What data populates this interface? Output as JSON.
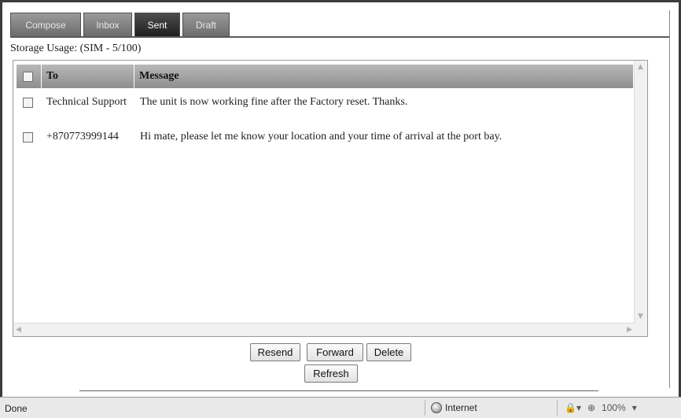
{
  "tabs": [
    {
      "label": "Compose",
      "active": false
    },
    {
      "label": "Inbox",
      "active": false
    },
    {
      "label": "Sent",
      "active": true
    },
    {
      "label": "Draft",
      "active": false
    }
  ],
  "storage_label": "Storage Usage: (SIM - 5/100)",
  "table": {
    "columns": [
      "To",
      "Message"
    ],
    "rows": [
      {
        "to": "Technical Support",
        "message": "The unit is now working fine after the Factory reset. Thanks."
      },
      {
        "to": "+870773999144",
        "message": "Hi mate, please let me know your location and your time of arrival at the port bay."
      }
    ]
  },
  "buttons": {
    "resend": "Resend",
    "forward": "Forward",
    "delete": "Delete",
    "refresh": "Refresh"
  },
  "statusbar": {
    "status": "Done",
    "zone": "Internet",
    "zoom": "100%"
  },
  "icons": [
    "checkbox-icon",
    "globe-icon",
    "magnifier-icon",
    "lock-icon"
  ],
  "colors": {
    "active_tab": "#2a2a2a",
    "inactive_tab": "#808080",
    "header_bg": "#a3a3a3"
  }
}
